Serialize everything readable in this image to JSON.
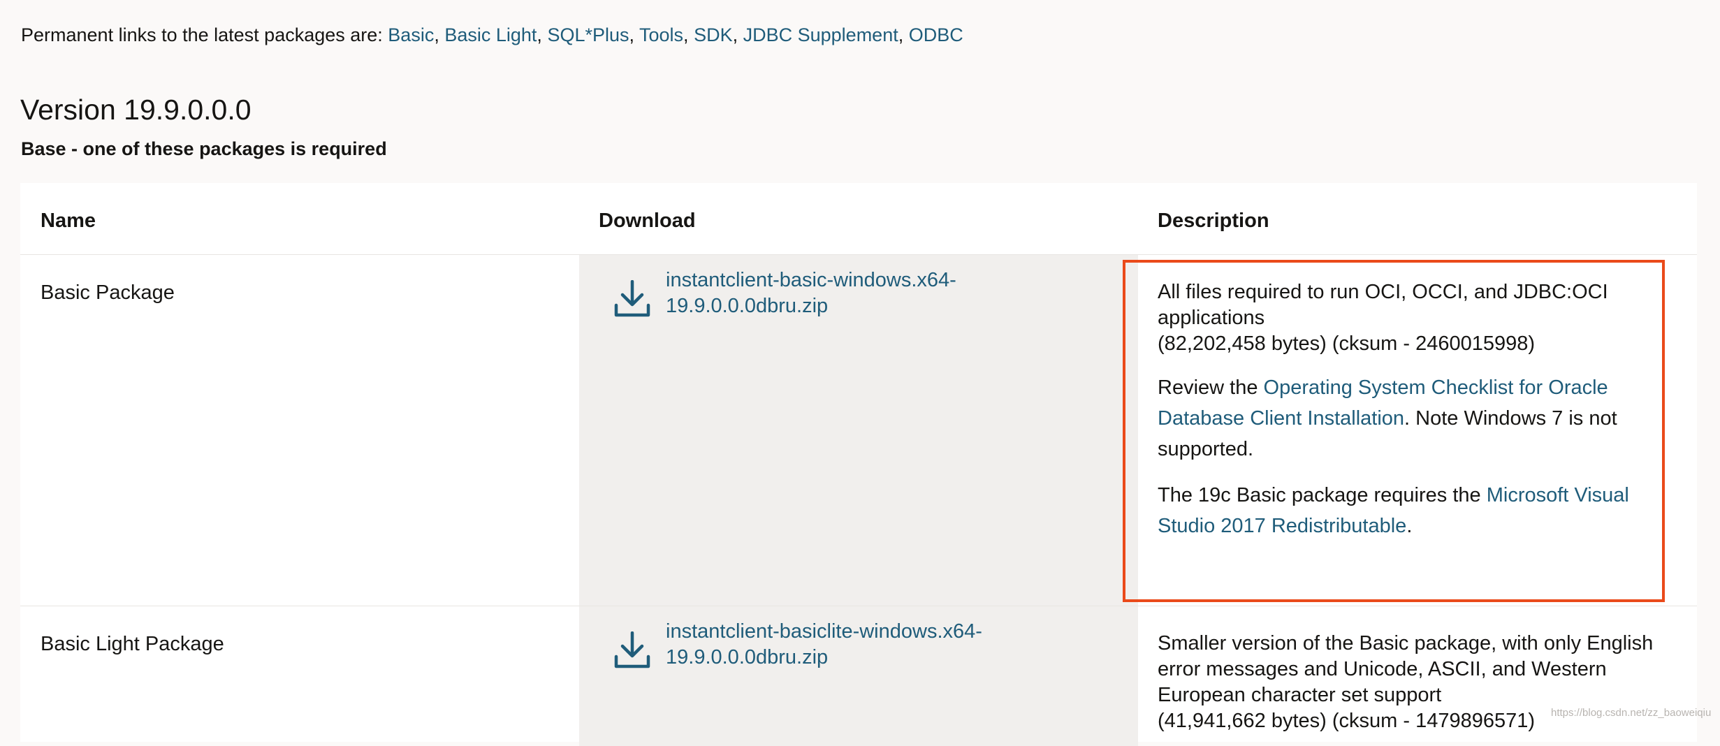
{
  "intro": {
    "prefix": "Permanent links to the latest packages are: ",
    "links": [
      "Basic",
      "Basic Light",
      "SQL*Plus",
      "Tools",
      "SDK",
      "JDBC Supplement",
      "ODBC"
    ],
    "separator": ", "
  },
  "version_title": "Version 19.9.0.0.0",
  "subheading": "Base - one of these packages is required",
  "table": {
    "headers": [
      "Name",
      "Download",
      "Description"
    ],
    "rows": [
      {
        "name": "Basic Package",
        "download": "instantclient-basic-windows.x64-19.9.0.0.0dbru.zip",
        "desc_line1": "All files required to run OCI, OCCI, and JDBC:OCI applications",
        "desc_size": "(82,202,458 bytes) (cksum - 2460015998)",
        "review_prefix": "Review the ",
        "review_link": "Operating System Checklist for Oracle Database Client Installation",
        "review_suffix": ". Note Windows 7 is not supported.",
        "vs_prefix": "The 19c Basic package requires the ",
        "vs_link": "Microsoft Visual Studio 2017 Redistributable",
        "vs_suffix": "."
      },
      {
        "name": "Basic Light Package",
        "download": "instantclient-basiclite-windows.x64-19.9.0.0.0dbru.zip",
        "desc_line1": "Smaller version of the Basic package, with only English error messages and Unicode, ASCII, and Western European character set support",
        "desc_size": "(41,941,662 bytes) (cksum - 1479896571)"
      }
    ]
  },
  "watermark": "https://blog.csdn.net/zz_baoweiqiu",
  "colors": {
    "link": "#1f5c7a",
    "highlight_border": "#ea4a1a",
    "download_column_bg": "#f1efed",
    "page_bg": "#fbf9f8"
  },
  "icons": {
    "download": "download-icon"
  }
}
